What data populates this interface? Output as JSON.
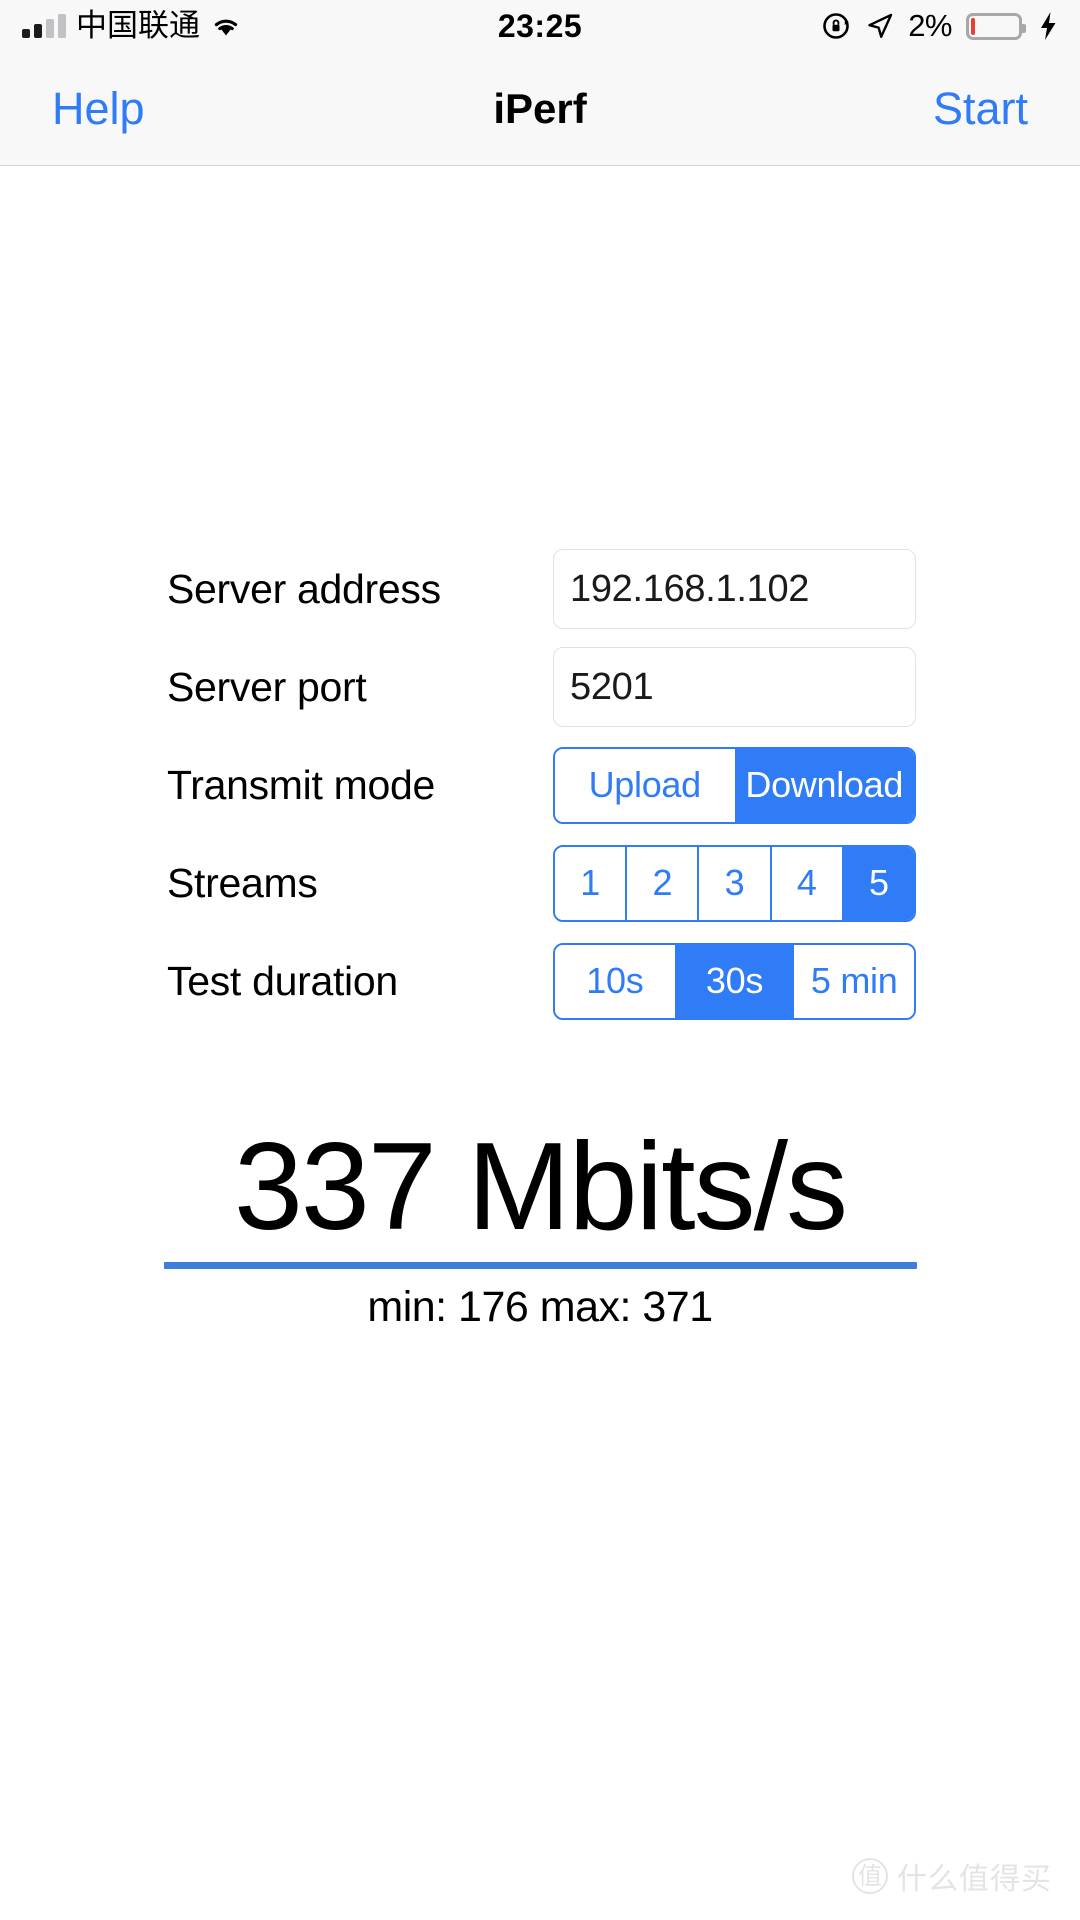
{
  "status_bar": {
    "carrier": "中国联通",
    "time": "23:25",
    "battery_percent": "2%",
    "signal_bars_filled": 2,
    "signal_bars_total": 4,
    "icons": [
      "signal-bars",
      "wifi-icon",
      "rotation-lock-icon",
      "location-arrow-icon",
      "battery-icon",
      "charging-bolt-icon"
    ],
    "battery_level_pct": 2,
    "battery_color": "#e8412f"
  },
  "nav_bar": {
    "left_button": "Help",
    "title": "iPerf",
    "right_button": "Start",
    "accent_color": "#2f7cf6"
  },
  "form": {
    "rows": [
      {
        "label": "Server address",
        "type": "textfield",
        "value": "192.168.1.102",
        "placeholder": "Server address"
      },
      {
        "label": "Server port",
        "type": "textfield",
        "value": "5201",
        "placeholder": "Server port"
      },
      {
        "label": "Transmit mode",
        "type": "segmented",
        "options": [
          "Upload",
          "Download"
        ],
        "selected_index": 1
      },
      {
        "label": "Streams",
        "type": "segmented",
        "options": [
          "1",
          "2",
          "3",
          "4",
          "5"
        ],
        "selected_index": 4
      },
      {
        "label": "Test duration",
        "type": "segmented",
        "options": [
          "10s",
          "30s",
          "5 min"
        ],
        "selected_index": 1
      }
    ]
  },
  "result": {
    "value": "337 Mbits/s",
    "throughput": 337,
    "unit": "Mbits/s",
    "min_max": "min: 176 max: 371",
    "min": 176,
    "max": 371,
    "divider_color": "#3d7fdb"
  },
  "watermark": {
    "logo_glyph": "值",
    "text": "什么值得买"
  }
}
